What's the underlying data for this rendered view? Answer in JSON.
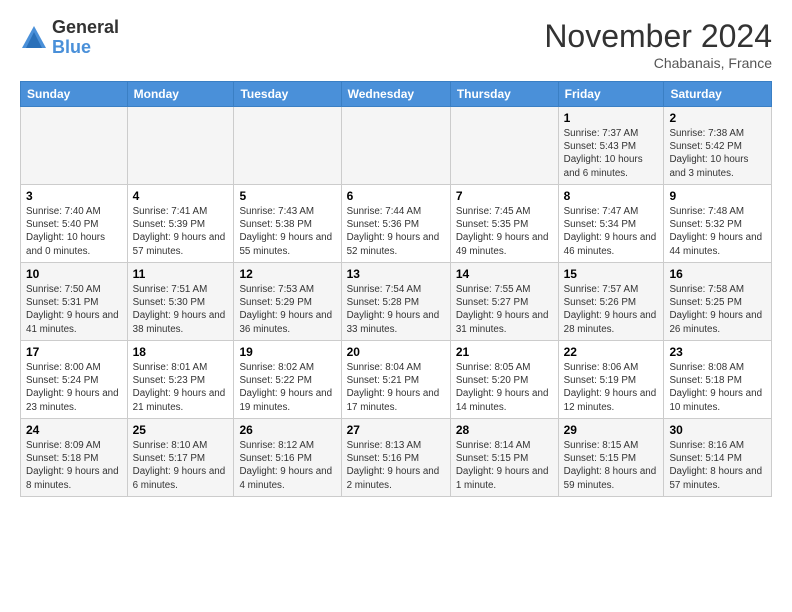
{
  "logo": {
    "general": "General",
    "blue": "Blue"
  },
  "title": "November 2024",
  "location": "Chabanais, France",
  "days_of_week": [
    "Sunday",
    "Monday",
    "Tuesday",
    "Wednesday",
    "Thursday",
    "Friday",
    "Saturday"
  ],
  "weeks": [
    [
      {
        "day": "",
        "info": ""
      },
      {
        "day": "",
        "info": ""
      },
      {
        "day": "",
        "info": ""
      },
      {
        "day": "",
        "info": ""
      },
      {
        "day": "",
        "info": ""
      },
      {
        "day": "1",
        "info": "Sunrise: 7:37 AM\nSunset: 5:43 PM\nDaylight: 10 hours\nand 6 minutes."
      },
      {
        "day": "2",
        "info": "Sunrise: 7:38 AM\nSunset: 5:42 PM\nDaylight: 10 hours\nand 3 minutes."
      }
    ],
    [
      {
        "day": "3",
        "info": "Sunrise: 7:40 AM\nSunset: 5:40 PM\nDaylight: 10 hours\nand 0 minutes."
      },
      {
        "day": "4",
        "info": "Sunrise: 7:41 AM\nSunset: 5:39 PM\nDaylight: 9 hours\nand 57 minutes."
      },
      {
        "day": "5",
        "info": "Sunrise: 7:43 AM\nSunset: 5:38 PM\nDaylight: 9 hours\nand 55 minutes."
      },
      {
        "day": "6",
        "info": "Sunrise: 7:44 AM\nSunset: 5:36 PM\nDaylight: 9 hours\nand 52 minutes."
      },
      {
        "day": "7",
        "info": "Sunrise: 7:45 AM\nSunset: 5:35 PM\nDaylight: 9 hours\nand 49 minutes."
      },
      {
        "day": "8",
        "info": "Sunrise: 7:47 AM\nSunset: 5:34 PM\nDaylight: 9 hours\nand 46 minutes."
      },
      {
        "day": "9",
        "info": "Sunrise: 7:48 AM\nSunset: 5:32 PM\nDaylight: 9 hours\nand 44 minutes."
      }
    ],
    [
      {
        "day": "10",
        "info": "Sunrise: 7:50 AM\nSunset: 5:31 PM\nDaylight: 9 hours\nand 41 minutes."
      },
      {
        "day": "11",
        "info": "Sunrise: 7:51 AM\nSunset: 5:30 PM\nDaylight: 9 hours\nand 38 minutes."
      },
      {
        "day": "12",
        "info": "Sunrise: 7:53 AM\nSunset: 5:29 PM\nDaylight: 9 hours\nand 36 minutes."
      },
      {
        "day": "13",
        "info": "Sunrise: 7:54 AM\nSunset: 5:28 PM\nDaylight: 9 hours\nand 33 minutes."
      },
      {
        "day": "14",
        "info": "Sunrise: 7:55 AM\nSunset: 5:27 PM\nDaylight: 9 hours\nand 31 minutes."
      },
      {
        "day": "15",
        "info": "Sunrise: 7:57 AM\nSunset: 5:26 PM\nDaylight: 9 hours\nand 28 minutes."
      },
      {
        "day": "16",
        "info": "Sunrise: 7:58 AM\nSunset: 5:25 PM\nDaylight: 9 hours\nand 26 minutes."
      }
    ],
    [
      {
        "day": "17",
        "info": "Sunrise: 8:00 AM\nSunset: 5:24 PM\nDaylight: 9 hours\nand 23 minutes."
      },
      {
        "day": "18",
        "info": "Sunrise: 8:01 AM\nSunset: 5:23 PM\nDaylight: 9 hours\nand 21 minutes."
      },
      {
        "day": "19",
        "info": "Sunrise: 8:02 AM\nSunset: 5:22 PM\nDaylight: 9 hours\nand 19 minutes."
      },
      {
        "day": "20",
        "info": "Sunrise: 8:04 AM\nSunset: 5:21 PM\nDaylight: 9 hours\nand 17 minutes."
      },
      {
        "day": "21",
        "info": "Sunrise: 8:05 AM\nSunset: 5:20 PM\nDaylight: 9 hours\nand 14 minutes."
      },
      {
        "day": "22",
        "info": "Sunrise: 8:06 AM\nSunset: 5:19 PM\nDaylight: 9 hours\nand 12 minutes."
      },
      {
        "day": "23",
        "info": "Sunrise: 8:08 AM\nSunset: 5:18 PM\nDaylight: 9 hours\nand 10 minutes."
      }
    ],
    [
      {
        "day": "24",
        "info": "Sunrise: 8:09 AM\nSunset: 5:18 PM\nDaylight: 9 hours\nand 8 minutes."
      },
      {
        "day": "25",
        "info": "Sunrise: 8:10 AM\nSunset: 5:17 PM\nDaylight: 9 hours\nand 6 minutes."
      },
      {
        "day": "26",
        "info": "Sunrise: 8:12 AM\nSunset: 5:16 PM\nDaylight: 9 hours\nand 4 minutes."
      },
      {
        "day": "27",
        "info": "Sunrise: 8:13 AM\nSunset: 5:16 PM\nDaylight: 9 hours\nand 2 minutes."
      },
      {
        "day": "28",
        "info": "Sunrise: 8:14 AM\nSunset: 5:15 PM\nDaylight: 9 hours\nand 1 minute."
      },
      {
        "day": "29",
        "info": "Sunrise: 8:15 AM\nSunset: 5:15 PM\nDaylight: 8 hours\nand 59 minutes."
      },
      {
        "day": "30",
        "info": "Sunrise: 8:16 AM\nSunset: 5:14 PM\nDaylight: 8 hours\nand 57 minutes."
      }
    ]
  ]
}
